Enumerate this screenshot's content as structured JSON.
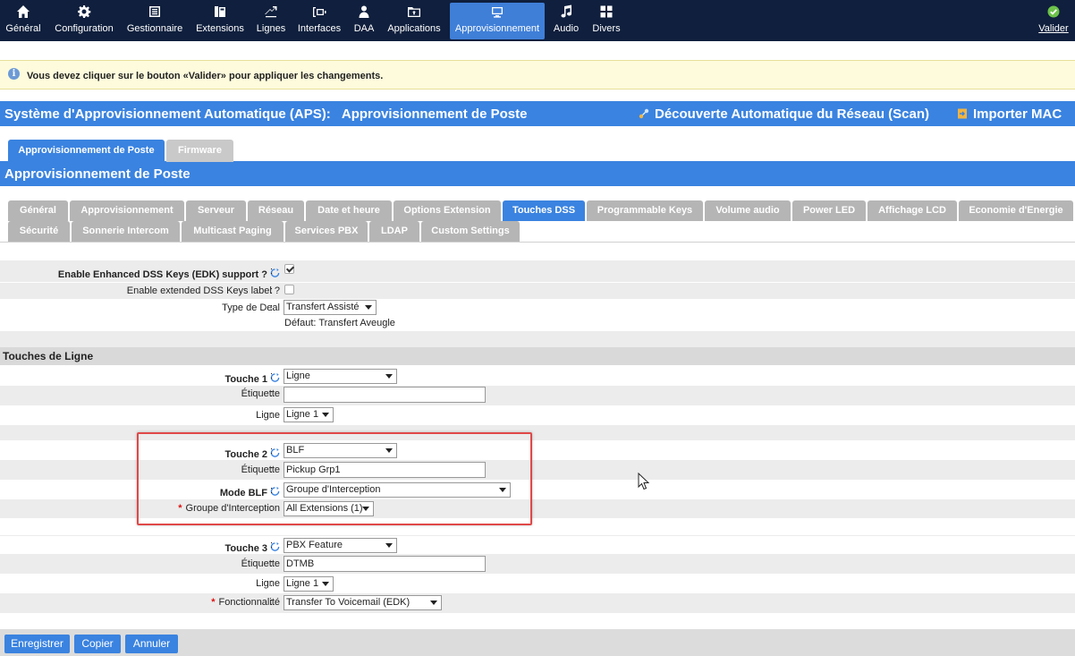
{
  "nav": {
    "items": [
      {
        "label": "Général",
        "icon": "home-icon"
      },
      {
        "label": "Configuration",
        "icon": "gear-icon"
      },
      {
        "label": "Gestionnaire",
        "icon": "list-icon"
      },
      {
        "label": "Extensions",
        "icon": "phone-icon"
      },
      {
        "label": "Lignes",
        "icon": "lines-icon"
      },
      {
        "label": "Interfaces",
        "icon": "interfaces-icon"
      },
      {
        "label": "DAA",
        "icon": "person-icon"
      },
      {
        "label": "Applications",
        "icon": "apps-icon"
      },
      {
        "label": "Approvisionnement",
        "icon": "provisioning-icon"
      },
      {
        "label": "Audio",
        "icon": "music-icon"
      },
      {
        "label": "Divers",
        "icon": "grid-icon"
      }
    ],
    "active": "Approvisionnement",
    "valider_label": "Valider"
  },
  "notice": {
    "text": "Vous devez cliquer sur le bouton «Valider» pour appliquer les changements."
  },
  "aps_header": {
    "title": "Système d'Approvisionnement Automatique (APS):",
    "subtitle": "Approvisionnement de Poste",
    "discovery_label": "Découverte Automatique du Réseau (Scan)",
    "import_label": "Importer MAC"
  },
  "main_tabs": [
    {
      "label": "Approvisionnement de Poste",
      "active": true
    },
    {
      "label": "Firmware",
      "active": false
    }
  ],
  "section_title": "Approvisionnement de Poste",
  "sub_tabs": {
    "row1": [
      "Général",
      "Approvisionnement",
      "Serveur",
      "Réseau",
      "Date et heure",
      "Options Extension",
      "Touches DSS",
      "Programmable Keys",
      "Volume audio",
      "Power LED",
      "Affichage LCD",
      "Economie d'Energie"
    ],
    "row2": [
      "Sécurité",
      "Sonnerie Intercom",
      "Multicast Paging",
      "Services PBX",
      "LDAP",
      "Custom Settings"
    ],
    "active": "Touches DSS"
  },
  "form": {
    "edk_label": "Enable Enhanced DSS Keys (EDK) support ?",
    "edk_checked": true,
    "ext_label": "Enable extended DSS Keys label ?",
    "ext_checked": false,
    "deal_label": "Type de Deal",
    "deal_value": "Transfert Assisté",
    "deal_default": "Défaut: Transfert Aveugle",
    "section_lines": "Touches de Ligne",
    "colon": ":",
    "touche1": {
      "label": "Touche 1",
      "type": "Ligne",
      "etiquette_label": "Étiquette",
      "etiquette": "",
      "ligne_label": "Ligne",
      "ligne": "Ligne 1"
    },
    "touche2": {
      "label": "Touche 2",
      "type": "BLF",
      "etiquette_label": "Étiquette",
      "etiquette": "Pickup Grp1",
      "mode_label": "Mode BLF",
      "mode": "Groupe d'Interception",
      "groupe_label": "Groupe d'Interception",
      "groupe": "All Extensions (1)"
    },
    "touche3": {
      "label": "Touche 3",
      "type": "PBX Feature",
      "etiquette_label": "Étiquette",
      "etiquette": "DTMB",
      "ligne_label": "Ligne",
      "ligne": "Ligne 1",
      "fonction_label": "Fonctionnalité",
      "fonction": "Transfer To Voicemail (EDK)"
    }
  },
  "footer": {
    "save": "Enregistrer",
    "copy": "Copier",
    "cancel": "Annuler"
  },
  "colors": {
    "nav_bg": "#0f1f3d",
    "accent": "#3a83e0",
    "highlight": "#e04848",
    "valider_icon": "#6cc24a"
  }
}
